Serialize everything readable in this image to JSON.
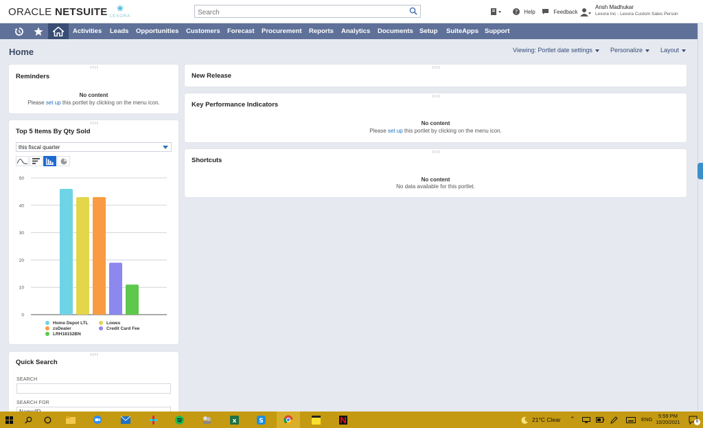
{
  "header": {
    "logo_primary": "ORACLE",
    "logo_secondary": "NETSUITE",
    "company_logo_text": "LEXORA",
    "search_placeholder": "Search",
    "help_label": "Help",
    "feedback_label": "Feedback",
    "user_name": "Ansh Madhukar",
    "user_role": "Lexora Inc - Lexora Custom Sales Person"
  },
  "nav": {
    "items": [
      {
        "label": "Activities"
      },
      {
        "label": "Leads"
      },
      {
        "label": "Opportunities"
      },
      {
        "label": "Customers"
      },
      {
        "label": "Forecast"
      },
      {
        "label": "Procurement"
      },
      {
        "label": "Reports"
      },
      {
        "label": "Analytics"
      },
      {
        "label": "Documents"
      },
      {
        "label": "Setup"
      },
      {
        "label": "SuiteApps"
      },
      {
        "label": "Support"
      }
    ]
  },
  "page": {
    "title": "Home",
    "viewing_label": "Viewing: Portlet date settings",
    "personalize_label": "Personalize",
    "layout_label": "Layout"
  },
  "portlets": {
    "reminders": {
      "title": "Reminders",
      "no_content": "No content",
      "msg_before": "Please ",
      "msg_link": "set up",
      "msg_after": " this portlet by clicking on the menu icon."
    },
    "top_items": {
      "title": "Top 5 Items By Qty Sold",
      "period_value": "this fiscal quarter"
    },
    "quick_search": {
      "title": "Quick Search",
      "search_label": "SEARCH",
      "search_for_label": "SEARCH FOR",
      "search_for_value": "Name/ID"
    },
    "new_release": {
      "title": "New Release"
    },
    "kpi": {
      "title": "Key Performance Indicators",
      "no_content": "No content",
      "msg_before": "Please ",
      "msg_link": "set up",
      "msg_after": " this portlet by clicking on the menu icon."
    },
    "shortcuts": {
      "title": "Shortcuts",
      "no_content": "No content",
      "msg": "No data available for this portlet."
    }
  },
  "chart_data": {
    "type": "bar",
    "categories": [
      "Home Depot LTL",
      "Lowes",
      "zsDealer",
      "Credit Card Fee",
      "LRH18152BN"
    ],
    "values": [
      46,
      43,
      43,
      19,
      11
    ],
    "colors": [
      "#6fd3e6",
      "#e3d64b",
      "#f99b42",
      "#8c88ef",
      "#5dc84c"
    ],
    "yticks": [
      0,
      10,
      20,
      30,
      40,
      50
    ],
    "ylim": [
      0,
      50
    ],
    "grid": true,
    "legend_position": "bottom"
  },
  "taskbar": {
    "weather": "21°C  Clear",
    "language": "ENG",
    "time": "5:59 PM",
    "date": "10/20/2021",
    "notification_count": "6"
  }
}
